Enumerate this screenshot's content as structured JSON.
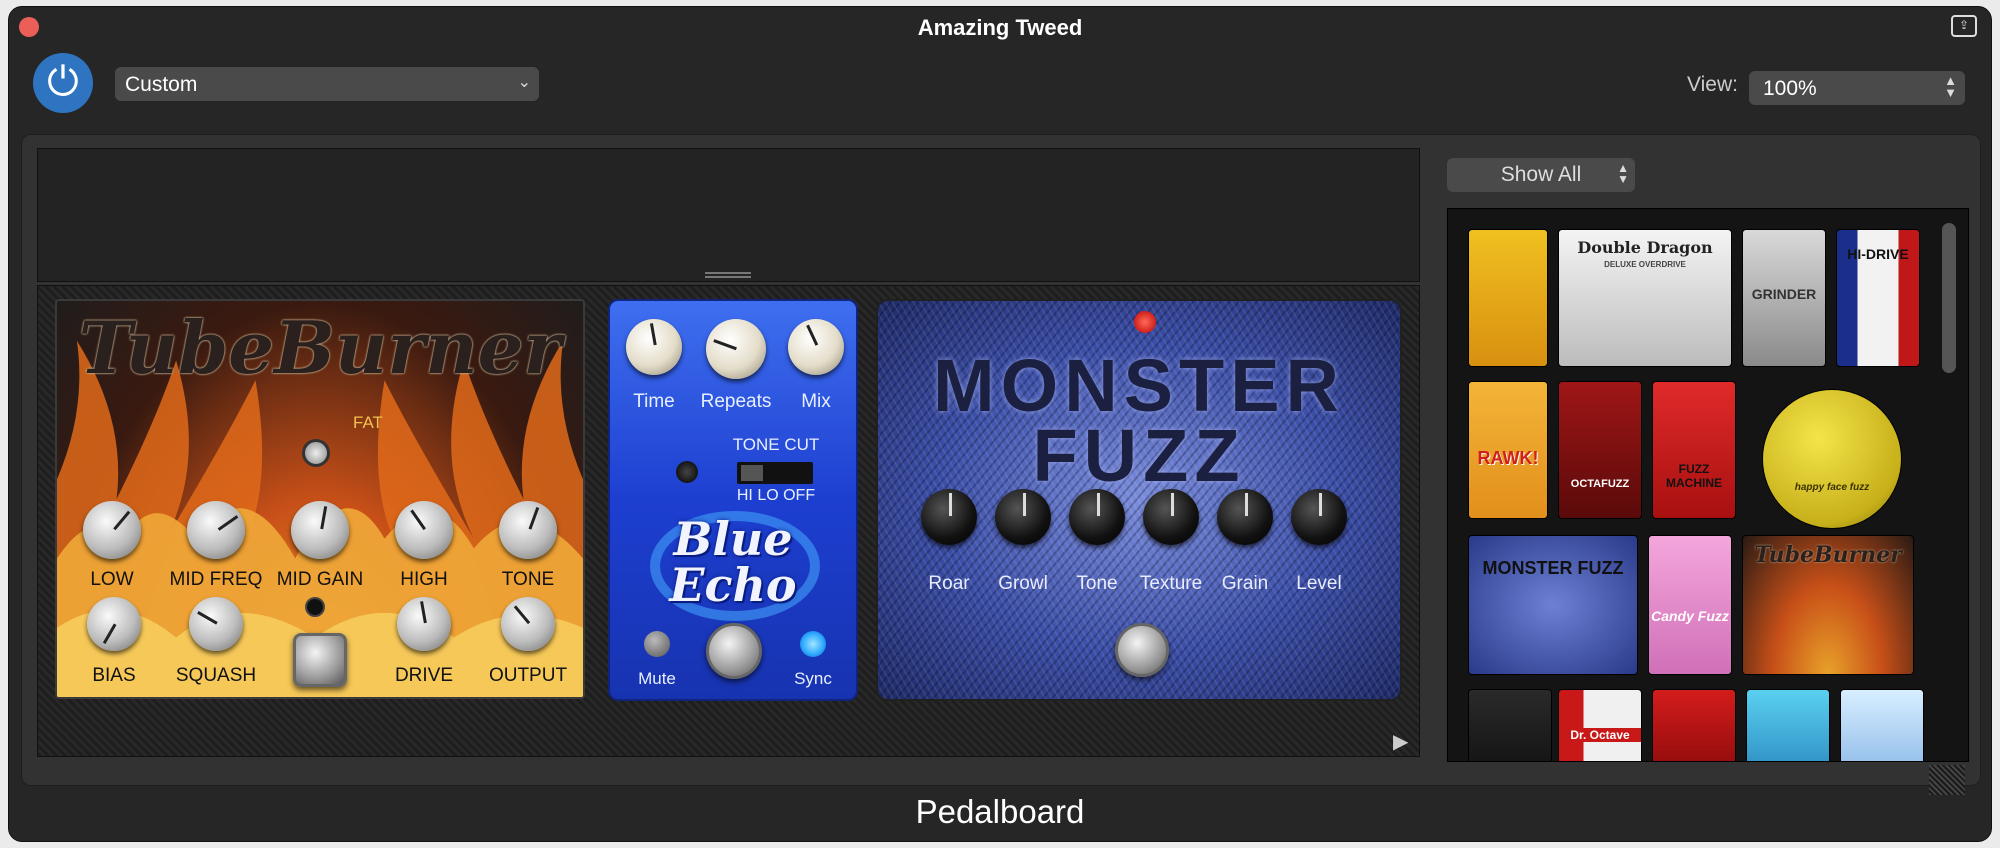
{
  "window": {
    "title": "Amazing Tweed",
    "close_label": "",
    "footer_title": "Pedalboard"
  },
  "toolbar": {
    "preset": "Custom",
    "view_label": "View:",
    "view_value": "100%"
  },
  "pedals": {
    "tube_burner": {
      "name": "TubeBurner",
      "fat_label": "FAT",
      "knobs_top": [
        "LOW",
        "MID FREQ",
        "MID GAIN",
        "HIGH",
        "TONE"
      ],
      "knobs_bottom": [
        "BIAS",
        "SQUASH",
        "DRIVE",
        "OUTPUT"
      ]
    },
    "blue_echo": {
      "name_line1": "Blue",
      "name_line2": "Echo",
      "knobs": [
        "Time",
        "Repeats",
        "Mix"
      ],
      "tone_cut_label": "TONE CUT",
      "switch_label": "HI LO OFF",
      "mute_label": "Mute",
      "sync_label": "Sync"
    },
    "monster_fuzz": {
      "name_line1": "MONSTER",
      "name_line2": "FUZZ",
      "knobs": [
        "Roar",
        "Growl",
        "Tone",
        "Texture",
        "Grain",
        "Level"
      ]
    }
  },
  "library": {
    "filter": "Show All",
    "thumbs": {
      "double_dragon": "Double Dragon",
      "double_dragon_sub": "DELUXE OVERDRIVE",
      "grinder": "GRINDER",
      "hi_drive": "HI-DRIVE",
      "rawk": "RAWK!",
      "octafuzz": "OCTAFUZZ",
      "fuzz_machine": "FUZZ MACHINE",
      "happy_face": "happy face fuzz",
      "monster_fuzz": "MONSTER FUZZ",
      "candy_fuzz": "Candy Fuzz",
      "tube_burner": "TubeBurner",
      "dr_octave": "Dr. Octave"
    }
  },
  "colors": {
    "window_bg": "#262626",
    "power_blue": "#2f74c0",
    "close_red": "#ec5f58"
  }
}
